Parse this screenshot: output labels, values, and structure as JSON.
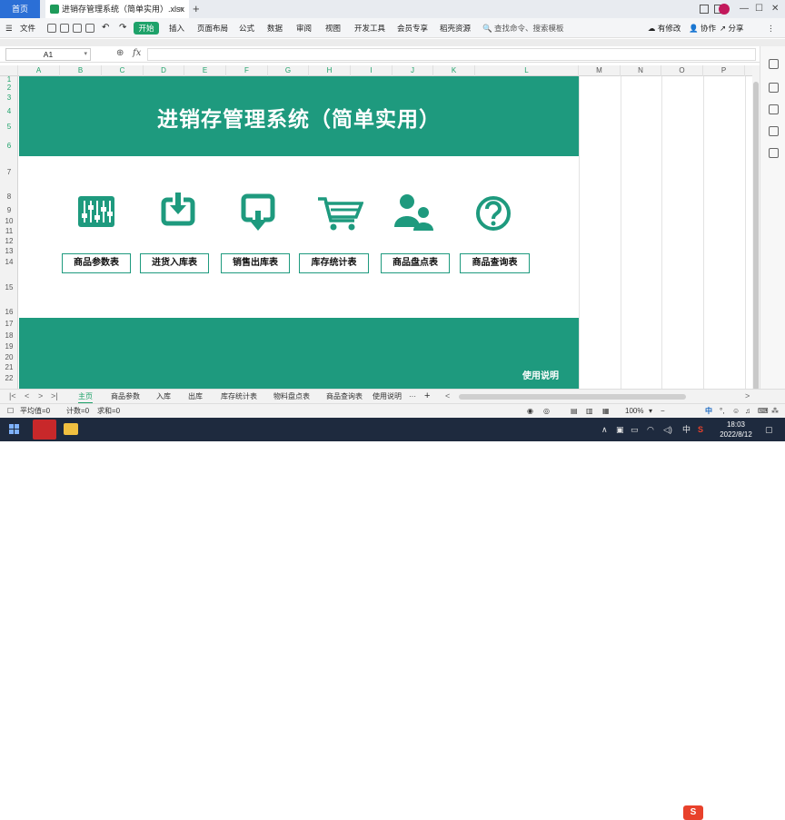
{
  "titlebar": {
    "home_tab": "首页",
    "file_tab": "进销存管理系统（简单实用）.xlsx",
    "close_x": "×",
    "add_tab": "+",
    "win_buttons": [
      "—",
      "☐",
      "✕"
    ]
  },
  "menubar": {
    "file": "文件",
    "start": "开始",
    "items": [
      "插入",
      "页面布局",
      "公式",
      "数据",
      "审阅",
      "视图",
      "开发工具",
      "会员专享",
      "稻壳资源"
    ],
    "search_placeholder": "查找命令、搜索模板",
    "has_changes": "有修改",
    "collaborate": "协作",
    "share": "分享"
  },
  "formula": {
    "cell_ref": "A1",
    "fx": "fx",
    "value": ""
  },
  "columns": [
    "A",
    "B",
    "C",
    "D",
    "E",
    "F",
    "G",
    "H",
    "I",
    "J",
    "K",
    "L",
    "M",
    "N",
    "O",
    "P"
  ],
  "rows": [
    "1",
    "2",
    "3",
    "4",
    "5",
    "6",
    "7",
    "8",
    "9",
    "10",
    "11",
    "12",
    "13",
    "14",
    "15",
    "16",
    "17",
    "18",
    "19",
    "20",
    "21",
    "22"
  ],
  "sheet": {
    "title": "进销存管理系统（简单实用）",
    "buttons": [
      "商品参数表",
      "进货入库表",
      "销售出库表",
      "库存统计表",
      "商品盘点表",
      "商品查询表"
    ],
    "icons": [
      "equalizer-icon",
      "inbox-download-icon",
      "outbox-upload-icon",
      "shopping-cart-icon",
      "users-icon",
      "help-circle-icon"
    ],
    "usage": "使用说明",
    "accent_color": "#1e9a7e"
  },
  "sheet_tabs": {
    "tabs": [
      "主页",
      "商品参数",
      "入库",
      "出库",
      "库存统计表",
      "物料盘点表",
      "商品查询表",
      "使用说明"
    ],
    "active": "主页",
    "more": "···",
    "add": "+"
  },
  "statusbar": {
    "average": "平均值=0",
    "count": "计数=0",
    "sum": "求和=0",
    "zoom": "100%",
    "zoom_minus": "−"
  },
  "taskbar": {
    "time": "18:03",
    "date": "2022/8/12",
    "ime": "中",
    "tray_lang": "中"
  }
}
